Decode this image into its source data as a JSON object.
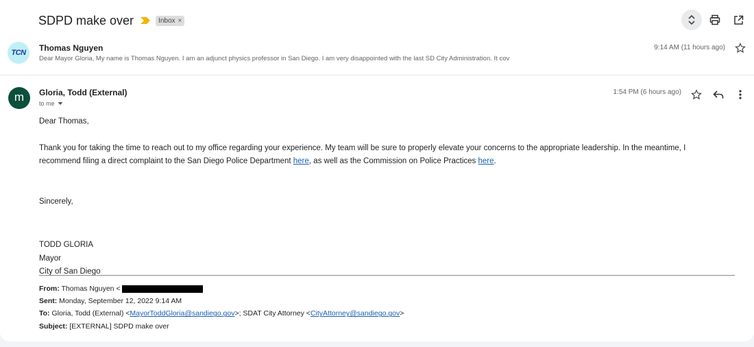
{
  "thread": {
    "subject": "SDPD make over",
    "label": "Inbox",
    "label_close": "×",
    "icons": [
      "expand-collapse-icon",
      "print-icon",
      "open-in-new-window-icon"
    ]
  },
  "message1": {
    "sender": "Thomas Nguyen",
    "avatar_text": "TCN",
    "snippet": "Dear Mayor Gloria, My name is Thomas Nguyen. I am an adjunct physics professor in San Diego. I am very disappointed with the last SD City Administration. It cov",
    "time": "9:14 AM (11 hours ago)"
  },
  "message2": {
    "sender": "Gloria, Todd (External)",
    "avatar_letter": "m",
    "to": "to me",
    "time": "1:54 PM (6 hours ago)",
    "accent": "#0b4f3c",
    "body": {
      "greeting": "Dear Thomas,",
      "p1_a": "Thank you for taking the time to reach out to my office regarding your experience. My team will be sure to properly elevate your concerns to the appropriate leadership. In the meantime, I recommend filing a direct complaint to the San Diego Police Department ",
      "link1": "here",
      "p1_b": ", as well as the Commission on Police Practices ",
      "link2": "here",
      "p1_c": ".",
      "closing": "Sincerely,",
      "sig_name": "TODD GLORIA",
      "sig_title": "Mayor",
      "sig_org": "City of San Diego"
    },
    "quoted": {
      "from_label": "From:",
      "from_value": "Thomas Nguyen <",
      "sent_label": "Sent:",
      "sent_value": "Monday, September 12, 2022 9:14 AM",
      "to_label": "To:",
      "to_prefix": "Gloria, Todd (External) <",
      "to_email1": "MayorToddGloria@sandiego.gov",
      "to_mid": ">; SDAT City Attorney <",
      "to_email2": "CityAttorney@sandiego.gov",
      "to_suffix": ">",
      "subject_label": "Subject:",
      "subject_value": "[EXTERNAL] SDPD make over"
    }
  }
}
